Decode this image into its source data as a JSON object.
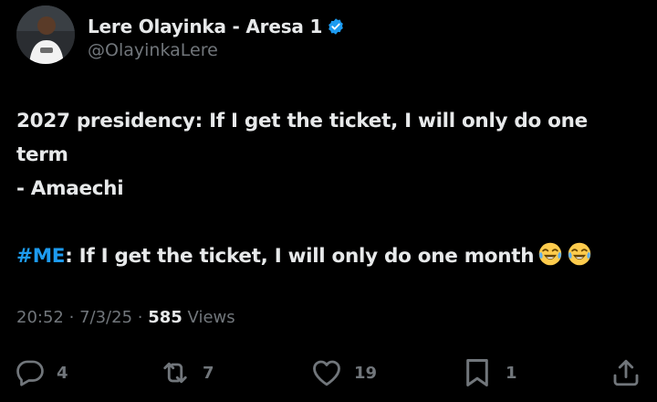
{
  "author": {
    "display_name": "Lere Olayinka - Aresa 1",
    "handle": "@OlayinkaLere",
    "verified": true,
    "avatar_icon": "profile-photo"
  },
  "tweet": {
    "line1": "2027 presidency: If I get the ticket, I will only do one",
    "line2": "term",
    "line3": "- Amaechi",
    "hashtag": "#ME",
    "line4_rest": ": If I get the ticket, I will only do one month",
    "emojis": [
      "😂",
      "😂"
    ]
  },
  "meta": {
    "time": "20:52",
    "separator": "·",
    "date": "7/3/25",
    "views_count": "585",
    "views_label": "Views"
  },
  "actions": {
    "replies": "4",
    "reposts": "7",
    "likes": "19",
    "bookmarks": "1"
  },
  "colors": {
    "background": "#000000",
    "text": "#e7e9ea",
    "secondary": "#71767b",
    "accent": "#1d9bf0",
    "verified_badge": "#1d9bf0"
  }
}
